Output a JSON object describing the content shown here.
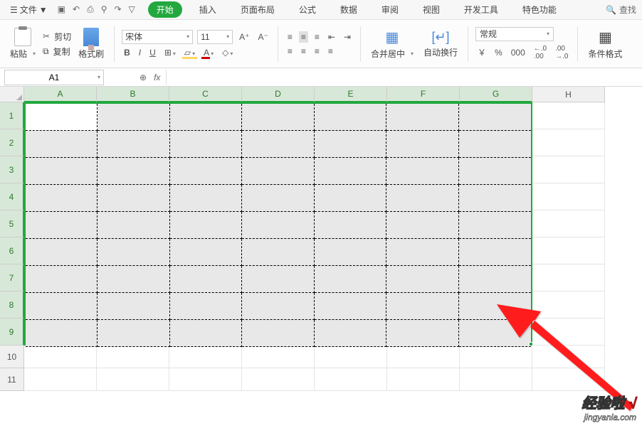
{
  "menubar": {
    "file_label": "文件",
    "tabs": [
      "开始",
      "插入",
      "页面布局",
      "公式",
      "数据",
      "审阅",
      "视图",
      "开发工具",
      "特色功能"
    ],
    "active_tab_index": 0,
    "search_label": "查找"
  },
  "ribbon": {
    "paste_label": "粘贴",
    "cut_label": "剪切",
    "copy_label": "复制",
    "format_painter_label": "格式刷",
    "font_name": "宋体",
    "font_size": "11",
    "bold": "B",
    "italic": "I",
    "underline": "U",
    "increase_font": "A⁺",
    "decrease_font": "A⁻",
    "strike": "A",
    "merge_center_label": "合并居中",
    "wrap_text_label": "自动换行",
    "number_format": "常规",
    "currency": "￥",
    "percent": "%",
    "comma": "000",
    "inc_dec": ".0",
    "dec_dec": ".00",
    "cond_format_label": "条件格式"
  },
  "formula_bar": {
    "cell_ref": "A1",
    "fx": "fx",
    "formula": ""
  },
  "grid": {
    "columns": [
      "A",
      "B",
      "C",
      "D",
      "E",
      "F",
      "G",
      "H"
    ],
    "rows": [
      "1",
      "2",
      "3",
      "4",
      "5",
      "6",
      "7",
      "8",
      "9",
      "10",
      "11"
    ],
    "selected_cols": 7,
    "selected_rows": 9,
    "active_cell": "A1"
  },
  "watermark": {
    "line1": "经验啦",
    "check": "√",
    "line2": "jingyanla.com"
  }
}
